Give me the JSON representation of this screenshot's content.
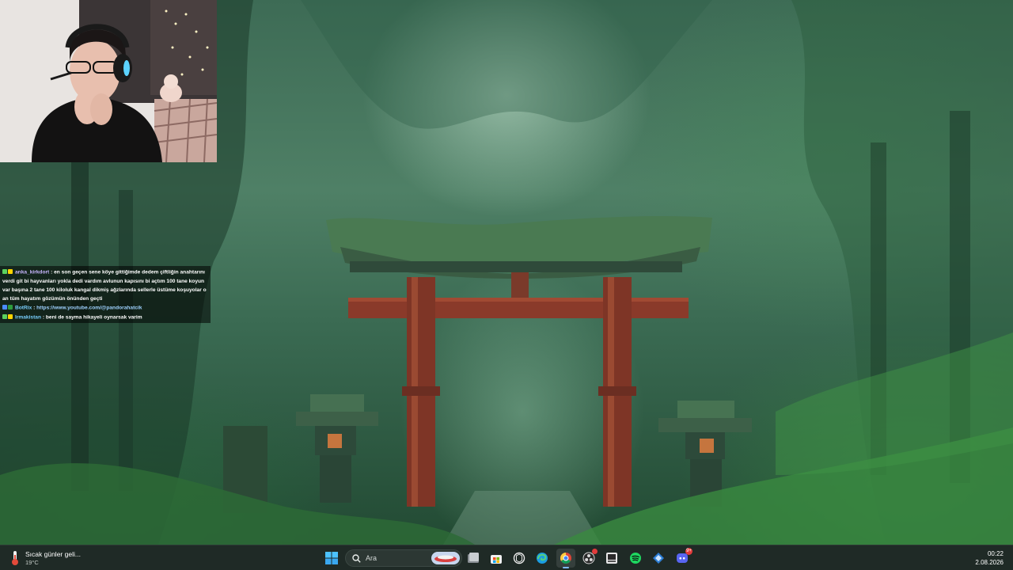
{
  "chat": {
    "messages": [
      {
        "user": "anka_kirkdort",
        "user_color": "#c9b6ff",
        "badges": [
          "sub",
          "vip"
        ],
        "text": "en son geçen sene köye gittiğimde dedem çiftliğin anahtarını verdi git bi hayvanları yokla dedi vardım avlunun kapısını bi açtım 100 tane koyun var başına 2 tane 100 kiloluk kangal dikmiş ağzlarında sellerle üstüme koşuyolar o an tüm hayatım gözümün önünden geçti"
      },
      {
        "user": "BotRix",
        "user_color": "#7ad0ff",
        "badges": [
          "bot",
          "mod"
        ],
        "text": "https://www.youtube.com/@pandorahatcik"
      },
      {
        "user": "Irmakistan",
        "user_color": "#7ad0ff",
        "badges": [
          "sub",
          "vip"
        ],
        "text": "beni de sayma hikayeli oynarsak varim"
      }
    ]
  },
  "taskbar": {
    "weather": {
      "title": "Sıcak günler geli...",
      "temp": "19°C",
      "icon": "thermometer-icon"
    },
    "search": {
      "placeholder": "Ara"
    },
    "apps": [
      {
        "name": "file-explorer-icon"
      },
      {
        "name": "microsoft-store-icon"
      },
      {
        "name": "chatgpt-icon"
      },
      {
        "name": "edge-icon"
      },
      {
        "name": "chrome-icon",
        "active": true
      },
      {
        "name": "obs-icon",
        "badge": ""
      },
      {
        "name": "streaming-app-icon"
      },
      {
        "name": "spotify-icon"
      },
      {
        "name": "game-launcher-icon"
      },
      {
        "name": "discord-icon",
        "badge": "9+"
      }
    ],
    "clock": {
      "time": "00:22",
      "date": "2.08.2026"
    }
  },
  "colors": {
    "taskbar_bg": "#1f2a26",
    "chat_bg": "rgba(0,0,0,0.55)",
    "accent": "#7fb9ff"
  }
}
